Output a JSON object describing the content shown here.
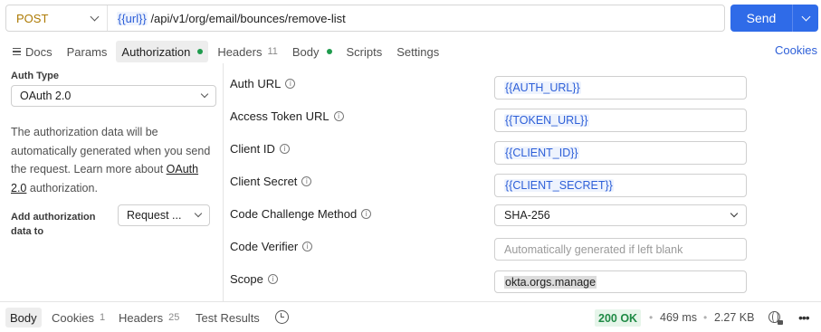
{
  "request": {
    "method": "POST",
    "url_var": "{{url}}",
    "url_path": " /api/v1/org/email/bounces/remove-list",
    "send_label": "Send"
  },
  "tabs": [
    {
      "label": "Docs"
    },
    {
      "label": "Params"
    },
    {
      "label": "Authorization"
    },
    {
      "label": "Headers",
      "count": "11"
    },
    {
      "label": "Body"
    },
    {
      "label": "Scripts"
    },
    {
      "label": "Settings"
    }
  ],
  "cookies_link": "Cookies",
  "auth": {
    "type_label": "Auth Type",
    "type_value": "OAuth 2.0",
    "desc_text": "The authorization data will be automatically generated when you send the request. Learn more about ",
    "desc_link": "OAuth 2.0",
    "desc_suffix": " authorization.",
    "add_label": "Add authorization data to",
    "add_value": "Request ..."
  },
  "fields": [
    {
      "label": "Auth URL",
      "value": "{{AUTH_URL}}"
    },
    {
      "label": "Access Token URL",
      "value": "{{TOKEN_URL}}"
    },
    {
      "label": "Client ID",
      "value": "{{CLIENT_ID}}"
    },
    {
      "label": "Client Secret",
      "value": "{{CLIENT_SECRET}}"
    },
    {
      "label": "Code Challenge Method",
      "value": "SHA-256"
    },
    {
      "label": "Code Verifier",
      "placeholder": "Automatically generated if left blank"
    },
    {
      "label": "Scope",
      "value": "okta.orgs.manage"
    }
  ],
  "response": {
    "tabs": [
      {
        "label": "Body"
      },
      {
        "label": "Cookies",
        "count": "1"
      },
      {
        "label": "Headers",
        "count": "25"
      },
      {
        "label": "Test Results"
      }
    ],
    "status": "200 OK",
    "time": "469 ms",
    "size": "2.27 KB"
  },
  "colors": {
    "accent": "#2f6be8",
    "method_post": "#ad7a03",
    "success": "#1f9b4d",
    "variable": "#2d5fd8"
  },
  "icons": [
    "chevron-down-icon",
    "docs-icon",
    "info-icon",
    "history-icon",
    "globe-icon",
    "more-icon"
  ]
}
